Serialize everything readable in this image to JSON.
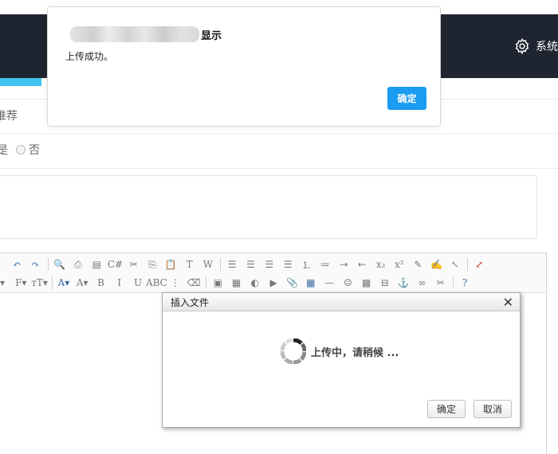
{
  "header": {
    "system_menu_label": "系统",
    "system_menu_icon": "gear-icon"
  },
  "form": {
    "recommend_label": "推荐",
    "radio_yes_label": "是",
    "radio_no_label": "否"
  },
  "editor": {
    "toolbar_row1": [
      {
        "name": "undo-icon",
        "glyph": "↶",
        "cls": "ic-blue"
      },
      {
        "name": "redo-icon",
        "glyph": "↷",
        "cls": "ic-blue"
      },
      {
        "sep": true
      },
      {
        "name": "preview-icon",
        "glyph": "🔍",
        "cls": "ic-gray"
      },
      {
        "name": "print-icon",
        "glyph": "⎙",
        "cls": "ic-gray"
      },
      {
        "name": "template-icon",
        "glyph": "▤",
        "cls": "ic-gray"
      },
      {
        "name": "code-icon",
        "glyph": "C#",
        "cls": "ic-gray"
      },
      {
        "name": "cut-icon",
        "glyph": "✂",
        "cls": "ic-gray"
      },
      {
        "name": "copy-icon",
        "glyph": "⎘",
        "cls": "ic-gray"
      },
      {
        "name": "paste-icon",
        "glyph": "📋",
        "cls": "ic-gray"
      },
      {
        "name": "paste-text-icon",
        "glyph": "T",
        "cls": "ic-gray"
      },
      {
        "name": "paste-word-icon",
        "glyph": "W",
        "cls": "ic-gray"
      },
      {
        "sep": true
      },
      {
        "name": "align-left-icon",
        "glyph": "☰",
        "cls": "ic-gray"
      },
      {
        "name": "align-center-icon",
        "glyph": "☰",
        "cls": "ic-gray"
      },
      {
        "name": "align-right-icon",
        "glyph": "☰",
        "cls": "ic-gray"
      },
      {
        "name": "align-justify-icon",
        "glyph": "☰",
        "cls": "ic-gray"
      },
      {
        "name": "ordered-list-icon",
        "glyph": "⒈",
        "cls": "ic-gray"
      },
      {
        "name": "unordered-list-icon",
        "glyph": "≔",
        "cls": "ic-gray"
      },
      {
        "name": "indent-icon",
        "glyph": "⇥",
        "cls": "ic-gray"
      },
      {
        "name": "outdent-icon",
        "glyph": "⇤",
        "cls": "ic-gray"
      },
      {
        "name": "subscript-icon",
        "glyph": "x₂",
        "cls": "ic-gray"
      },
      {
        "name": "superscript-icon",
        "glyph": "x²",
        "cls": "ic-gray"
      },
      {
        "name": "clear-format-icon",
        "glyph": "✎",
        "cls": "ic-gray"
      },
      {
        "name": "quick-format-icon",
        "glyph": "✍",
        "cls": "ic-gray"
      },
      {
        "name": "select-all-icon",
        "glyph": "↖",
        "cls": "ic-gray"
      },
      {
        "sep": true
      },
      {
        "name": "fullscreen-icon",
        "glyph": "⤢",
        "cls": "ic-red"
      }
    ],
    "toolbar_row2": [
      {
        "name": "format-block-icon",
        "glyph": "▾",
        "cls": "ic-gray"
      },
      {
        "name": "font-family-icon",
        "glyph": "F▾",
        "cls": "ic-gray"
      },
      {
        "name": "font-size-icon",
        "glyph": "тT▾",
        "cls": "ic-gray"
      },
      {
        "sep": true
      },
      {
        "name": "font-color-icon",
        "glyph": "A▾",
        "cls": "ic-blue"
      },
      {
        "name": "highlight-color-icon",
        "glyph": "A▾",
        "cls": "ic-gray"
      },
      {
        "name": "bold-icon",
        "glyph": "B",
        "cls": "ic-gray"
      },
      {
        "name": "italic-icon",
        "glyph": "I",
        "cls": "ic-gray"
      },
      {
        "name": "underline-icon",
        "glyph": "U",
        "cls": "ic-gray"
      },
      {
        "name": "strikethrough-icon",
        "glyph": "ABC",
        "cls": "ic-gray"
      },
      {
        "name": "line-height-icon",
        "glyph": "⋮",
        "cls": "ic-gray"
      },
      {
        "name": "remove-format-icon",
        "glyph": "⌫",
        "cls": "ic-gray"
      },
      {
        "sep": true
      },
      {
        "name": "image-icon",
        "glyph": "▣",
        "cls": "ic-gray"
      },
      {
        "name": "multi-image-icon",
        "glyph": "▦",
        "cls": "ic-gray"
      },
      {
        "name": "flash-icon",
        "glyph": "◐",
        "cls": "ic-gray"
      },
      {
        "name": "media-icon",
        "glyph": "▶",
        "cls": "ic-gray"
      },
      {
        "name": "insert-file-icon",
        "glyph": "📎",
        "cls": "ic-gray"
      },
      {
        "name": "table-icon",
        "glyph": "▦",
        "cls": "ic-blue"
      },
      {
        "name": "horizontal-rule-icon",
        "glyph": "—",
        "cls": "ic-gray"
      },
      {
        "name": "emoticon-icon",
        "glyph": "☺",
        "cls": "ic-gray"
      },
      {
        "name": "baidu-map-icon",
        "glyph": "▩",
        "cls": "ic-gray"
      },
      {
        "name": "page-break-icon",
        "glyph": "⊟",
        "cls": "ic-gray"
      },
      {
        "name": "anchor-icon",
        "glyph": "⚓",
        "cls": "ic-gray"
      },
      {
        "name": "link-icon",
        "glyph": "∞",
        "cls": "ic-gray"
      },
      {
        "name": "unlink-icon",
        "glyph": "✂",
        "cls": "ic-gray"
      },
      {
        "sep": true
      },
      {
        "name": "help-icon",
        "glyph": "?",
        "cls": "ic-blue"
      }
    ]
  },
  "insert_dialog": {
    "title": "插入文件",
    "close_glyph": "✕",
    "status_text": "上传中，请稍候 ...",
    "ok_label": "确定",
    "cancel_label": "取消"
  },
  "alert": {
    "title_suffix": "显示",
    "message": "上传成功。",
    "ok_label": "确定",
    "ok_color": "#1a9cf0"
  }
}
